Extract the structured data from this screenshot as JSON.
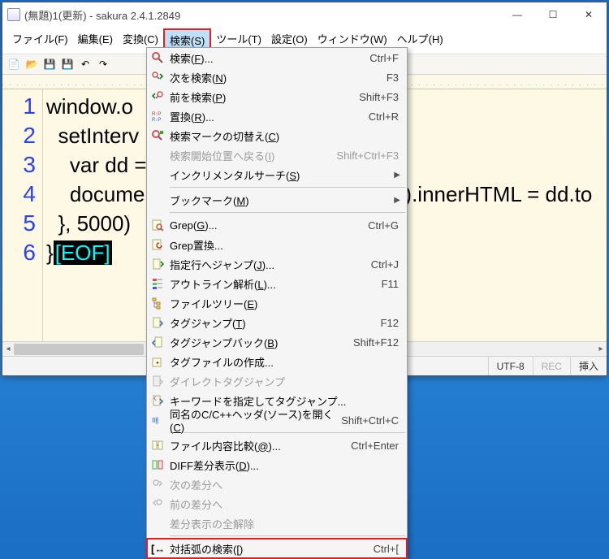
{
  "titlebar": {
    "title": "(無題)1(更新) - sakura 2.4.1.2849"
  },
  "winbuttons": {
    "min": "—",
    "max": "☐",
    "close": "✕"
  },
  "menubar": {
    "items": [
      {
        "label": "ファイル(F)"
      },
      {
        "label": "編集(E)"
      },
      {
        "label": "変換(C)"
      },
      {
        "label": "検索(S)",
        "active": true
      },
      {
        "label": "ツール(T)"
      },
      {
        "label": "設定(O)"
      },
      {
        "label": "ウィンドウ(W)"
      },
      {
        "label": "ヘルプ(H)"
      }
    ]
  },
  "gutter": [
    "1",
    "2",
    "3",
    "4",
    "5",
    "6"
  ],
  "code": {
    "l1": "window.o",
    "l2": "  setInterv",
    "l3": "    var dd =",
    "l4a": "    docume",
    "l4b": ").innerHTML = dd.to",
    "l5": "  }, 5000)",
    "l6a": "}",
    "l6eof": "[EOF]"
  },
  "status": {
    "encoding": "UTF-8",
    "rec": "REC",
    "ins": "挿入"
  },
  "menu": {
    "items": [
      {
        "icon": "search",
        "label": "検索(F)...",
        "shortcut": "Ctrl+F"
      },
      {
        "icon": "search-next",
        "label": "次を検索(N)",
        "shortcut": "F3"
      },
      {
        "icon": "search-prev",
        "label": "前を検索(P)",
        "shortcut": "Shift+F3"
      },
      {
        "icon": "replace",
        "label": "置換(R)...",
        "shortcut": "Ctrl+R"
      },
      {
        "icon": "search-mark",
        "label": "検索マークの切替え(C)",
        "shortcut": ""
      },
      {
        "icon": "",
        "label": "検索開始位置へ戻る(I)",
        "shortcut": "Shift+Ctrl+F3",
        "disabled": true
      },
      {
        "icon": "",
        "label": "インクリメンタルサーチ(S)",
        "submenu": true
      },
      {
        "sep": true
      },
      {
        "icon": "",
        "label": "ブックマーク(M)",
        "submenu": true
      },
      {
        "sep": true
      },
      {
        "icon": "grep",
        "label": "Grep(G)...",
        "shortcut": "Ctrl+G"
      },
      {
        "icon": "grep-rep",
        "label": "Grep置換...",
        "shortcut": ""
      },
      {
        "icon": "goto",
        "label": "指定行へジャンプ(J)...",
        "shortcut": "Ctrl+J"
      },
      {
        "icon": "outline",
        "label": "アウトライン解析(L)...",
        "shortcut": "F11"
      },
      {
        "icon": "tree",
        "label": "ファイルツリー(E)",
        "shortcut": ""
      },
      {
        "icon": "tag",
        "label": "タグジャンプ(T)",
        "shortcut": "F12"
      },
      {
        "icon": "tag-back",
        "label": "タグジャンプバック(B)",
        "shortcut": "Shift+F12"
      },
      {
        "icon": "tag-make",
        "label": "タグファイルの作成...",
        "shortcut": ""
      },
      {
        "icon": "tag-direct",
        "label": "ダイレクトタグジャンプ",
        "shortcut": "",
        "disabled": true
      },
      {
        "icon": "tag-kw",
        "label": "キーワードを指定してタグジャンプ...",
        "shortcut": ""
      },
      {
        "icon": "cpp",
        "label": "同名のC/C++ヘッダ(ソース)を開く(C)",
        "shortcut": "Shift+Ctrl+C"
      },
      {
        "sep": true
      },
      {
        "icon": "diff-file",
        "label": "ファイル内容比較(@)...",
        "shortcut": "Ctrl+Enter"
      },
      {
        "icon": "diff",
        "label": "DIFF差分表示(D)...",
        "shortcut": ""
      },
      {
        "icon": "diff-next",
        "label": "次の差分へ",
        "shortcut": "",
        "disabled": true
      },
      {
        "icon": "diff-prev",
        "label": "前の差分へ",
        "shortcut": "",
        "disabled": true
      },
      {
        "icon": "",
        "label": "差分表示の全解除",
        "shortcut": "",
        "disabled": true
      },
      {
        "sep": true
      },
      {
        "icon": "bracket",
        "label": "対括弧の検索([)",
        "shortcut": "Ctrl+[",
        "highlight": true
      }
    ]
  }
}
